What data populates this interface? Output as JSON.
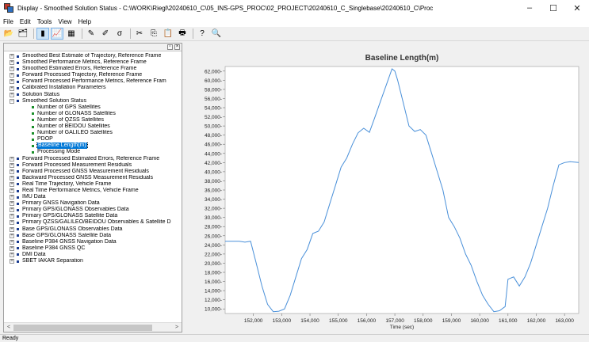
{
  "window": {
    "title": "Display - Smoothed Solution Status - C:\\WORK\\Riegl\\20240610_C\\05_INS-GPS_PROC\\02_PROJECT\\20240610_C_Singlebase\\20240610_C\\Proc",
    "minimize": "–",
    "maximize": "☐",
    "close": "✕"
  },
  "menu": [
    "File",
    "Edit",
    "Tools",
    "View",
    "Help"
  ],
  "toolbar": [
    {
      "icon": "open-folder-icon",
      "glyph": "📂"
    },
    {
      "icon": "properties-icon",
      "glyph": "🗂"
    },
    {
      "sep": true
    },
    {
      "icon": "tree-view-icon",
      "glyph": "▮",
      "active": true
    },
    {
      "icon": "chart-view-icon",
      "glyph": "📈",
      "active": true
    },
    {
      "icon": "table-view-icon",
      "glyph": "▦"
    },
    {
      "sep": true
    },
    {
      "icon": "pencil-icon",
      "glyph": "✎"
    },
    {
      "icon": "marker-icon",
      "glyph": "✐"
    },
    {
      "icon": "sigma-icon",
      "glyph": "σ"
    },
    {
      "sep": true
    },
    {
      "icon": "cut-icon",
      "glyph": "✂"
    },
    {
      "icon": "copy-icon",
      "glyph": "⎘"
    },
    {
      "icon": "paste-icon",
      "glyph": "📋"
    },
    {
      "icon": "print-icon",
      "glyph": "🖶"
    },
    {
      "sep": true
    },
    {
      "icon": "help-icon",
      "glyph": "?"
    },
    {
      "icon": "zoom-icon",
      "glyph": "🔍"
    }
  ],
  "tree": [
    {
      "label": "Smoothed Best Estimate of Trajectory, Reference Frame",
      "type": "parent",
      "expander": "+"
    },
    {
      "label": "Smoothed Performance Metrics, Reference Frame",
      "type": "parent",
      "expander": "+"
    },
    {
      "label": "Smoothed Estimated Errors, Reference Frame",
      "type": "parent",
      "expander": "+"
    },
    {
      "label": "Forward Processed Trajectory, Reference Frame",
      "type": "parent",
      "expander": "+"
    },
    {
      "label": "Forward Processed Performance Metrics, Reference Fram",
      "type": "parent",
      "expander": "+"
    },
    {
      "label": "Calibrated Installation Parameters",
      "type": "parent",
      "expander": "+"
    },
    {
      "label": "Solution Status",
      "type": "parent",
      "expander": "+"
    },
    {
      "label": "Smoothed Solution Status",
      "type": "parent",
      "expander": "−"
    },
    {
      "label": "Number of GPS Satellites",
      "type": "child"
    },
    {
      "label": "Number of GLONASS Satellites",
      "type": "child"
    },
    {
      "label": "Number of QZSS Satellites",
      "type": "child"
    },
    {
      "label": "Number of BEIDOU Satellites",
      "type": "child"
    },
    {
      "label": "Number of GALILEO Satellites",
      "type": "child"
    },
    {
      "label": "PDOP",
      "type": "child"
    },
    {
      "label": "Baseline Length(m)",
      "type": "child",
      "selected": true
    },
    {
      "label": "Processing Mode",
      "type": "child"
    },
    {
      "label": "Forward Processed Estimated Errors, Reference Frame",
      "type": "parent",
      "expander": "+"
    },
    {
      "label": "Forward Processed Measurement Residuals",
      "type": "parent",
      "expander": "+"
    },
    {
      "label": "Forward Processed GNSS Measurement Residuals",
      "type": "parent",
      "expander": "+"
    },
    {
      "label": "Backward Processed GNSS Measurement Residuals",
      "type": "parent",
      "expander": "+"
    },
    {
      "label": "Real Time Trajectory, Vehicle Frame",
      "type": "parent",
      "expander": "+"
    },
    {
      "label": "Real Time Performance Metrics, Vehicle Frame",
      "type": "parent",
      "expander": "+"
    },
    {
      "label": "IMU Data",
      "type": "parent",
      "expander": "+"
    },
    {
      "label": "Primary GNSS Navigation Data",
      "type": "parent",
      "expander": "+"
    },
    {
      "label": "Primary GPS/GLONASS Observables Data",
      "type": "parent",
      "expander": "+"
    },
    {
      "label": "Primary GPS/GLONASS Satellite Data",
      "type": "parent",
      "expander": "+"
    },
    {
      "label": "Primary QZSS/GALILEO/BEIDOU Observables & Satellite D",
      "type": "parent",
      "expander": "+"
    },
    {
      "label": "Base GPS/GLONASS Observables Data",
      "type": "parent",
      "expander": "+"
    },
    {
      "label": "Base GPS/GLONASS Satellite Data",
      "type": "parent",
      "expander": "+"
    },
    {
      "label": "Baseline P384 GNSS Navigation Data",
      "type": "parent",
      "expander": "+"
    },
    {
      "label": "Baseline P384 GNSS QC",
      "type": "parent",
      "expander": "+"
    },
    {
      "label": "DMI Data",
      "type": "parent",
      "expander": "+"
    },
    {
      "label": "SBET IAKAR Separation",
      "type": "parent",
      "expander": "+"
    }
  ],
  "pane_buttons": [
    "▫",
    "×"
  ],
  "scroll": {
    "left": "<",
    "right": ">"
  },
  "status": {
    "text": "Ready"
  },
  "chart_data": {
    "type": "line",
    "title": "Baseline Length(m)",
    "xlabel": "Time (sec)",
    "ylabel": "",
    "xlim": [
      151000,
      163500
    ],
    "ylim": [
      9000,
      63000
    ],
    "xticks": [
      152000,
      153000,
      154000,
      155000,
      156000,
      157000,
      158000,
      159000,
      160000,
      161000,
      162000,
      163000
    ],
    "yticks": [
      10000,
      12000,
      14000,
      16000,
      18000,
      20000,
      22000,
      24000,
      26000,
      28000,
      30000,
      32000,
      34000,
      36000,
      38000,
      40000,
      42000,
      44000,
      46000,
      48000,
      50000,
      52000,
      54000,
      56000,
      58000,
      60000,
      62000
    ],
    "grid": false,
    "line_color": "#4a90d9",
    "series": [
      {
        "x": [
          151000,
          151500,
          151700,
          151900,
          152100,
          152300,
          152500,
          152700,
          152900,
          153100,
          153300,
          153500,
          153700,
          153900,
          154100,
          154300,
          154500,
          154700,
          154900,
          155100,
          155300,
          155500,
          155700,
          155900,
          156100,
          156300,
          156500,
          156700,
          156900,
          157000,
          157100,
          157300,
          157500,
          157700,
          157900,
          158100,
          158300,
          158500,
          158700,
          158900,
          159100,
          159300,
          159500,
          159700,
          159900,
          160100,
          160300,
          160500,
          160700,
          160900,
          161000,
          161200,
          161400,
          161600,
          161800,
          162000,
          162200,
          162400,
          162600,
          162800,
          163000,
          163200,
          163500
        ],
        "values": [
          24800,
          24800,
          24600,
          24800,
          20000,
          15000,
          11000,
          9400,
          9500,
          10000,
          13000,
          17000,
          21000,
          23000,
          26500,
          27000,
          29000,
          33000,
          37000,
          41000,
          43000,
          46000,
          48500,
          49500,
          48600,
          52000,
          55500,
          59000,
          62500,
          62000,
          60000,
          55000,
          50000,
          48800,
          49200,
          48000,
          44000,
          40000,
          36000,
          30000,
          28000,
          25500,
          22000,
          19500,
          16000,
          13000,
          11000,
          9400,
          9600,
          10500,
          16500,
          17000,
          15000,
          17000,
          20000,
          24000,
          28000,
          32000,
          37000,
          41500,
          42000,
          42200,
          42000
        ]
      }
    ]
  }
}
